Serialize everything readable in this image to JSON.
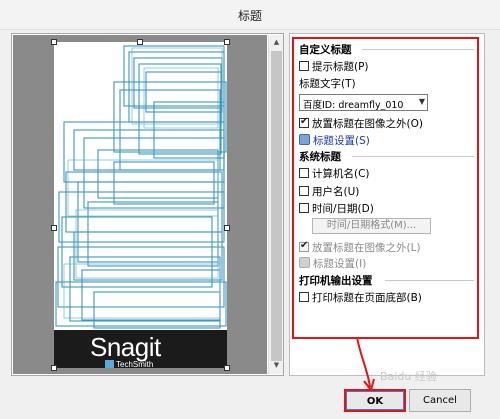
{
  "window": {
    "title": "标题"
  },
  "preview": {
    "brand_title": "Snagit",
    "brand_sub": "TechSmith"
  },
  "custom_title": {
    "header": "自定义标题",
    "prompt_title": {
      "label": "提示标题(P)",
      "checked": false
    },
    "title_text_label": "标题文字(T)",
    "title_text_value": "百度ID: dreamfly_010",
    "place_outside": {
      "label": "放置标题在图像之外(O)",
      "checked": true
    },
    "settings_link": "标题设置(S)"
  },
  "system_title": {
    "header": "系统标题",
    "computer_name": {
      "label": "计算机名(C)",
      "checked": false
    },
    "user_name": {
      "label": "用户名(U)",
      "checked": false
    },
    "datetime": {
      "label": "时间/日期(D)",
      "checked": false
    },
    "format_button": "时间/日期格式(M)...",
    "place_outside": {
      "label": "放置标题在图像之外(L)",
      "checked": true
    },
    "settings_link": "标题设置(I)"
  },
  "printer": {
    "header": "打印机输出设置",
    "print_bottom": {
      "label": "打印标题在页面底部(B)",
      "checked": false
    }
  },
  "buttons": {
    "ok": "OK",
    "cancel": "Cancel"
  },
  "watermark": "Baidu 经验",
  "colors": {
    "highlight": "#e21515",
    "link": "#1a3aa8"
  }
}
